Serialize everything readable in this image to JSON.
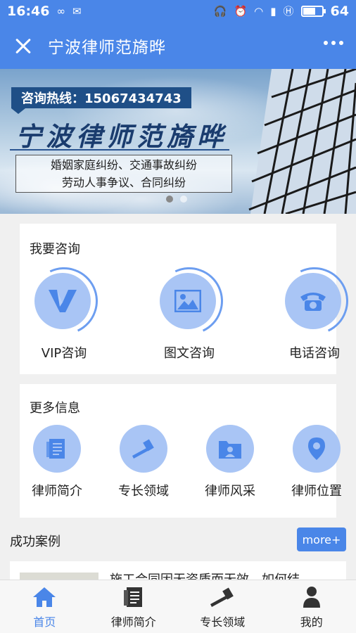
{
  "status_bar": {
    "time": "16:46",
    "battery": "64",
    "battery_level": 0.64
  },
  "nav": {
    "title": "宁波律师范旖晔"
  },
  "banner": {
    "hotline": "咨询热线：15067434743",
    "title": "宁波律师范旖晔",
    "line1": "婚姻家庭纠纷、交通事故纠纷",
    "line2": "劳动人事争议、合同纠纷",
    "slide_count": 2,
    "active_slide": 1
  },
  "consult": {
    "title": "我要咨询",
    "items": [
      {
        "label": "VIP咨询",
        "icon": "vip-v-icon"
      },
      {
        "label": "图文咨询",
        "icon": "image-icon"
      },
      {
        "label": "电话咨询",
        "icon": "telephone-icon"
      }
    ]
  },
  "more_info": {
    "title": "更多信息",
    "items": [
      {
        "label": "律师简介",
        "icon": "document-icon"
      },
      {
        "label": "专长领域",
        "icon": "gavel-icon"
      },
      {
        "label": "律师风采",
        "icon": "folder-person-icon"
      },
      {
        "label": "律师位置",
        "icon": "location-pin-icon"
      }
    ]
  },
  "cases": {
    "title": "成功案例",
    "more_label": "more+",
    "first_case": "施工合同因无资质而无效，如何结..."
  },
  "tabbar": {
    "tabs": [
      {
        "label": "首页",
        "icon": "home-icon",
        "active": true
      },
      {
        "label": "律师简介",
        "icon": "document-icon",
        "active": false
      },
      {
        "label": "专长领域",
        "icon": "gavel-icon",
        "active": false
      },
      {
        "label": "我的",
        "icon": "person-icon",
        "active": false
      }
    ]
  },
  "colors": {
    "primary": "#4a86e8",
    "icon_bg": "#a9c5f5",
    "icon_fg": "#4a86e8"
  }
}
